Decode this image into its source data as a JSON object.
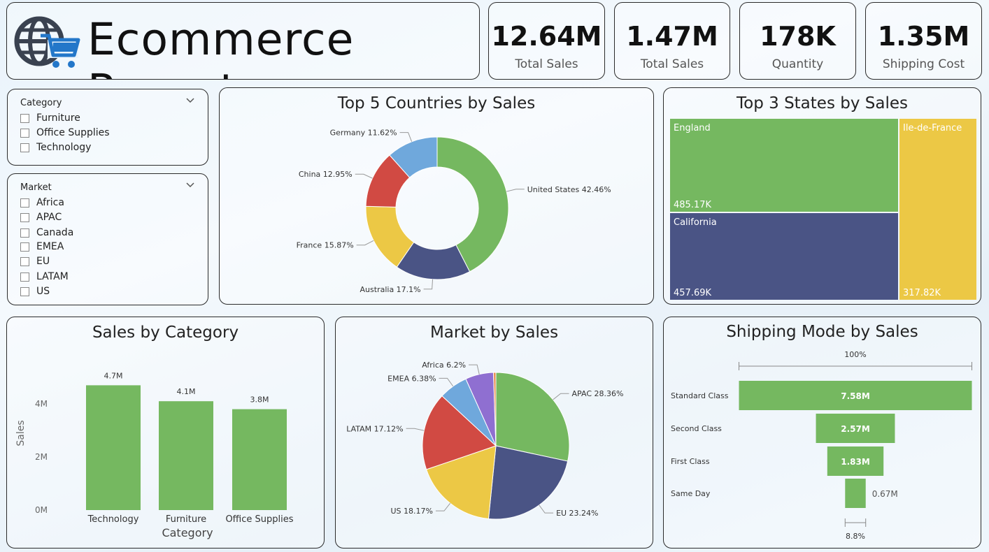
{
  "header": {
    "title": "Ecommerce Report",
    "logo_icon": "globe-cart-icon"
  },
  "kpis": [
    {
      "value": "12.64M",
      "label": "Total Sales"
    },
    {
      "value": "1.47M",
      "label": "Total Sales"
    },
    {
      "value": "178K",
      "label": "Quantity"
    },
    {
      "value": "1.35M",
      "label": "Shipping Cost"
    }
  ],
  "slicers": {
    "category": {
      "title": "Category",
      "options": [
        "Furniture",
        "Office Supplies",
        "Technology"
      ]
    },
    "market": {
      "title": "Market",
      "options": [
        "Africa",
        "APAC",
        "Canada",
        "EMEA",
        "EU",
        "LATAM",
        "US"
      ]
    }
  },
  "colors": {
    "green": "#75b860",
    "navy": "#4a5485",
    "yellow": "#ecc845",
    "red": "#d14a43",
    "blue": "#6fa8dc",
    "purple": "#8f6fd1",
    "orange": "#e8884a"
  },
  "chart_data": [
    {
      "type": "pie",
      "variant": "donut",
      "title": "Top 5 Countries by Sales",
      "slices": [
        {
          "label": "United States",
          "value": 42.46,
          "text": "United States 42.46%",
          "color": "#75b860"
        },
        {
          "label": "Australia",
          "value": 17.1,
          "text": "Australia 17.1%",
          "color": "#4a5485"
        },
        {
          "label": "France",
          "value": 15.87,
          "text": "France 15.87%",
          "color": "#ecc845"
        },
        {
          "label": "China",
          "value": 12.95,
          "text": "China 12.95%",
          "color": "#d14a43"
        },
        {
          "label": "Germany",
          "value": 11.62,
          "text": "Germany 11.62%",
          "color": "#6fa8dc"
        }
      ]
    },
    {
      "type": "treemap",
      "title": "Top 3 States by Sales",
      "items": [
        {
          "label": "England",
          "value": 485.17,
          "text": "485.17K",
          "color": "#75b860"
        },
        {
          "label": "California",
          "value": 457.69,
          "text": "457.69K",
          "color": "#4a5485"
        },
        {
          "label": "Ile-de-France",
          "value": 317.82,
          "text": "317.82K",
          "color": "#ecc845"
        }
      ]
    },
    {
      "type": "bar",
      "title": "Sales by Category",
      "xlabel": "Category",
      "ylabel": "Sales",
      "ylim": [
        0,
        5
      ],
      "yticks": [
        "0M",
        "2M",
        "4M"
      ],
      "categories": [
        "Technology",
        "Furniture",
        "Office Supplies"
      ],
      "values": [
        4.7,
        4.1,
        3.8
      ],
      "value_labels": [
        "4.7M",
        "4.1M",
        "3.8M"
      ],
      "color": "#75b860"
    },
    {
      "type": "pie",
      "title": "Market by Sales",
      "slices": [
        {
          "label": "APAC",
          "value": 28.36,
          "text": "APAC 28.36%",
          "color": "#75b860"
        },
        {
          "label": "EU",
          "value": 23.24,
          "text": "EU 23.24%",
          "color": "#4a5485"
        },
        {
          "label": "US",
          "value": 18.17,
          "text": "US 18.17%",
          "color": "#ecc845"
        },
        {
          "label": "LATAM",
          "value": 17.12,
          "text": "LATAM 17.12%",
          "color": "#d14a43"
        },
        {
          "label": "EMEA",
          "value": 6.38,
          "text": "EMEA 6.38%",
          "color": "#6fa8dc"
        },
        {
          "label": "Africa",
          "value": 6.2,
          "text": "Africa 6.2%",
          "color": "#8f6fd1"
        },
        {
          "label": "Canada",
          "value": 0.53,
          "text": "",
          "color": "#e8884a"
        }
      ]
    },
    {
      "type": "funnel",
      "title": "Shipping Mode by Sales",
      "top_pct": "100%",
      "bottom_pct": "8.8%",
      "stages": [
        {
          "label": "Standard Class",
          "value": 7.58,
          "text": "7.58M"
        },
        {
          "label": "Second Class",
          "value": 2.57,
          "text": "2.57M"
        },
        {
          "label": "First Class",
          "value": 1.83,
          "text": "1.83M"
        },
        {
          "label": "Same Day",
          "value": 0.67,
          "text": "0.67M"
        }
      ],
      "color": "#75b860"
    }
  ]
}
